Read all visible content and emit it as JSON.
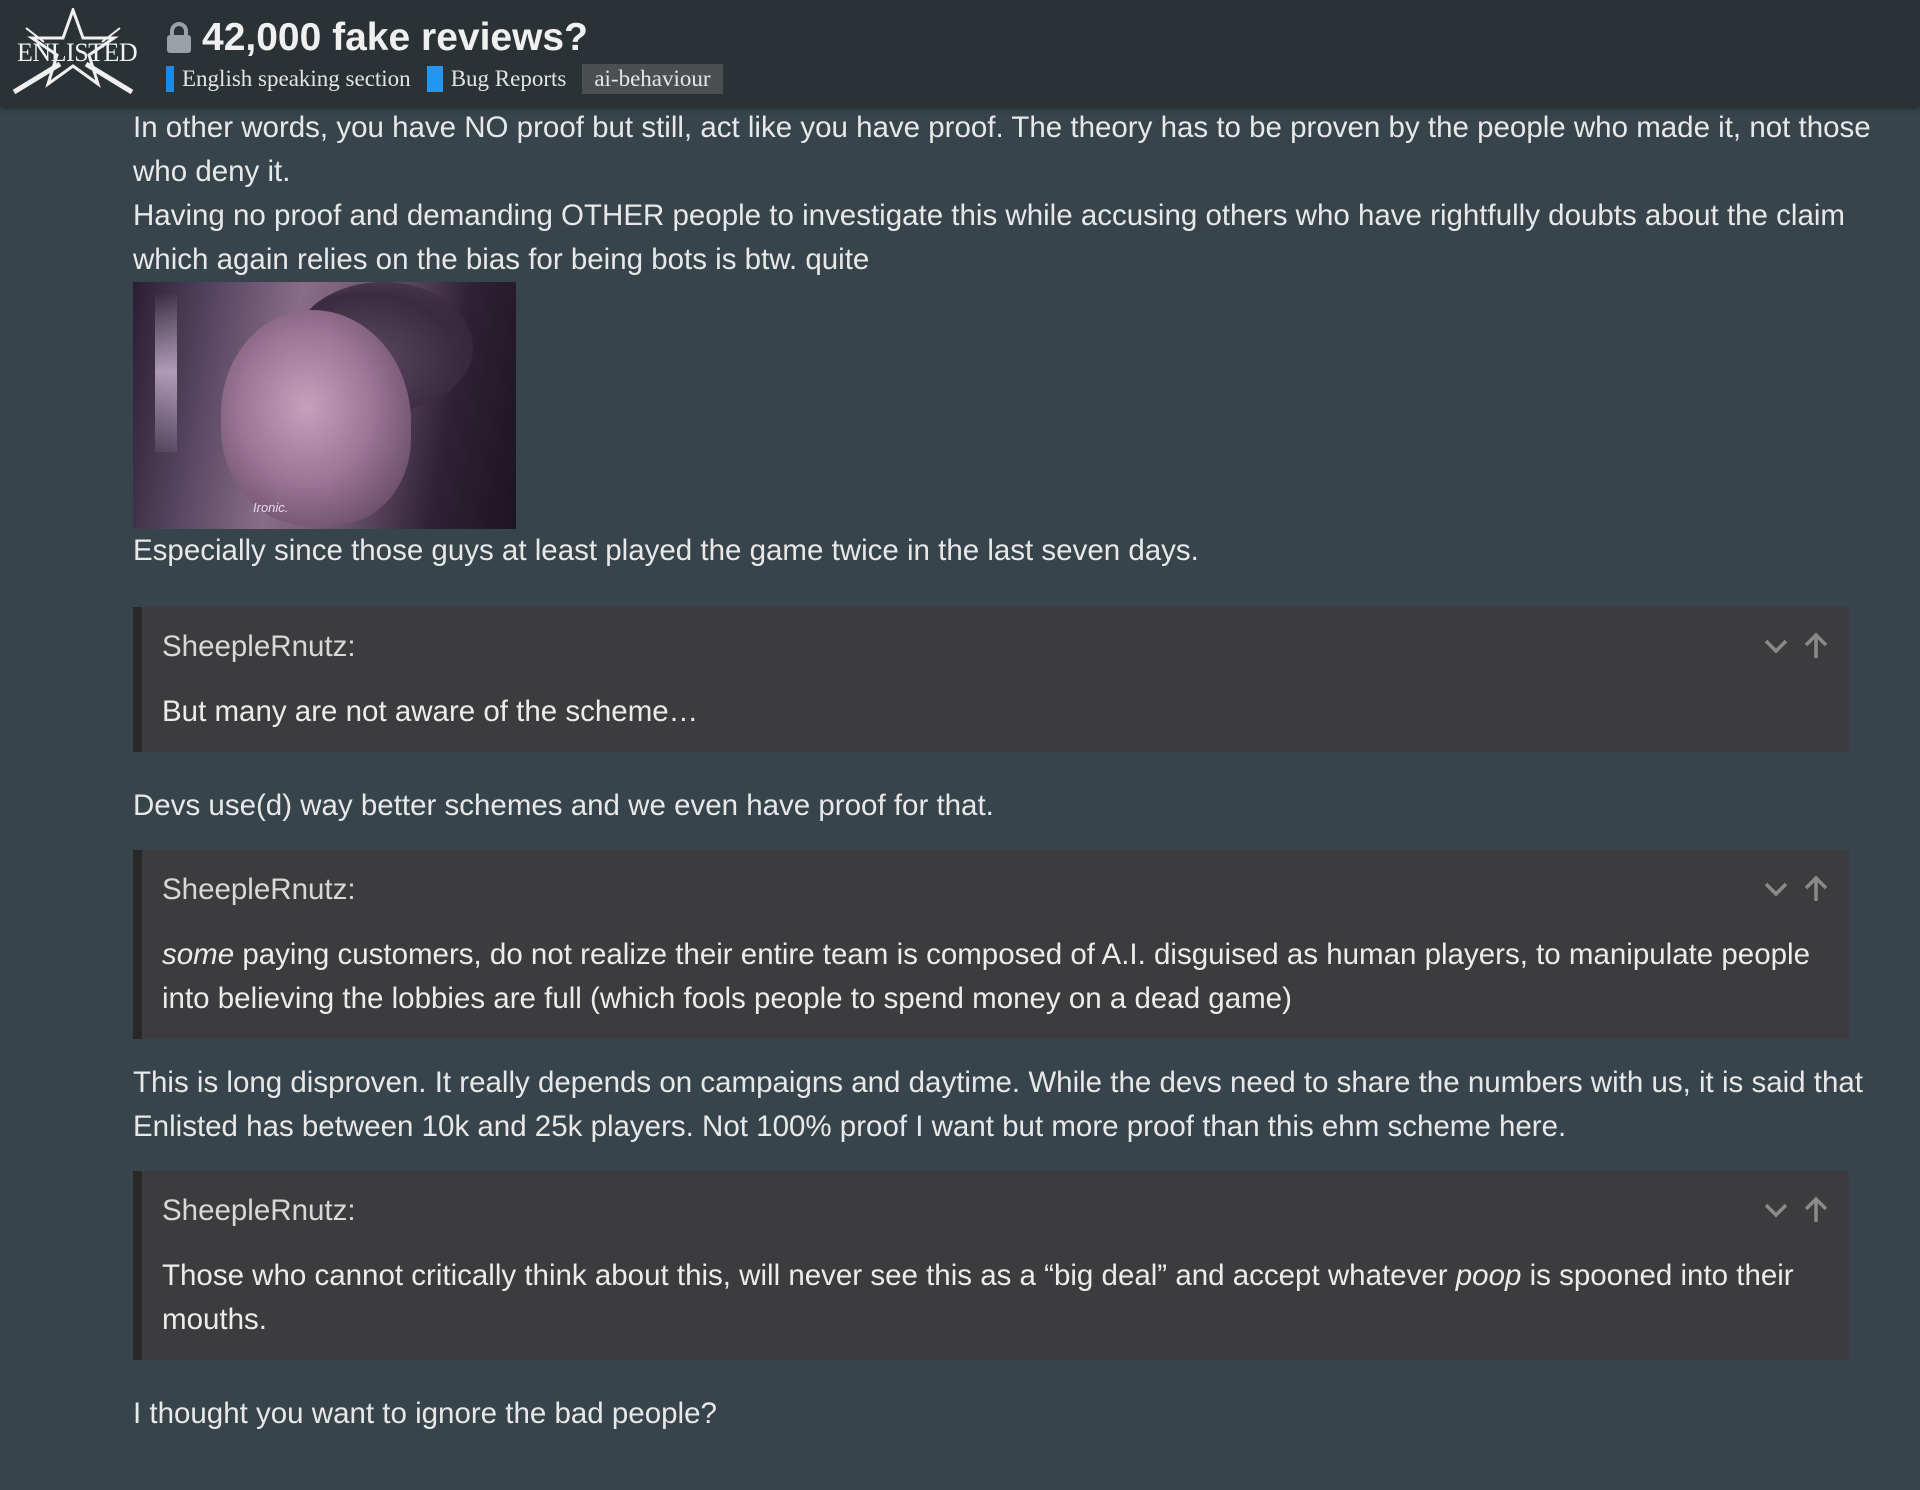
{
  "header": {
    "logo_text": "ENLISTED",
    "title": "42,000 fake reviews?",
    "categories": [
      "English speaking section",
      "Bug Reports"
    ],
    "tag": "ai-behaviour"
  },
  "post": {
    "p1": "In other words, you have NO proof but still, act like you have proof. The theory has to be proven by the people who made it, not those who deny it.",
    "p2": "Having no proof and demanding OTHER people to investigate this while accusing others who have rightfully doubts about the claim which again relies on the bias for being bots is btw. quite",
    "meme_caption": "Ironic.",
    "p3": "Especially since those guys at least played the game twice in the last seven days.",
    "quotes": [
      {
        "author": "SheepleRnutz:",
        "pre": "",
        "em": "",
        "text": "But many are not aware of the scheme…",
        "post_text": ""
      },
      {
        "author": "SheepleRnutz:",
        "pre": "",
        "em": "some",
        "text": " paying customers, do not realize their entire team is composed of A.I. disguised as human players, to manipulate people into believing the lobbies are full (which fools people to spend money on a dead game)",
        "post_text": ""
      },
      {
        "author": "SheepleRnutz:",
        "pre": "Those who cannot critically think about this, will never see this as a “big deal” and accept whatever ",
        "em": "poop",
        "text": " is spooned into their mouths.",
        "post_text": ""
      }
    ],
    "p4": "Devs use(d) way better schemes and we even have proof for that.",
    "p5": "This is long disproven. It really depends on campaigns and daytime. While the devs need to share the numbers with us, it is said that Enlisted has between 10k and 25k players. Not 100% proof I want but more proof than this ehm scheme here.",
    "p6": "I thought you want to ignore the bad people?"
  },
  "icons": {
    "lock": "lock-icon",
    "expand": "chevron-down-icon",
    "jump": "arrow-up-icon"
  },
  "colors": {
    "background": "#37444c",
    "header": "#2b3236",
    "quote_bg": "#3c3c3e",
    "category_blue": "#1e88e5"
  }
}
